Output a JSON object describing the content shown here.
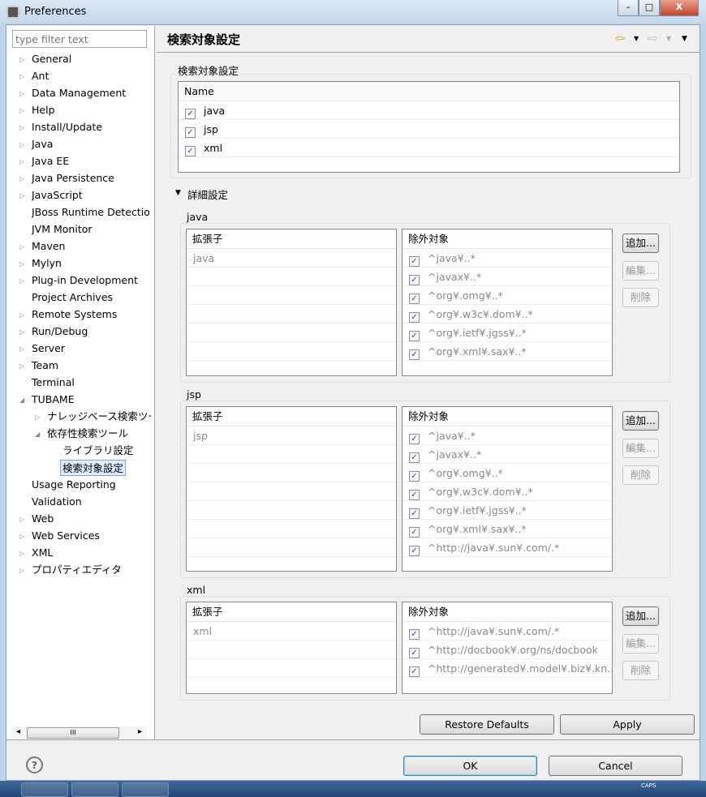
{
  "window": {
    "title": "Preferences",
    "minimize": "–",
    "maximize": "□",
    "close": "X"
  },
  "filter": {
    "placeholder": "type filter text"
  },
  "tree": [
    {
      "label": "General",
      "twisty": "▷",
      "level": 0
    },
    {
      "label": "Ant",
      "twisty": "▷",
      "level": 0
    },
    {
      "label": "Data Management",
      "twisty": "▷",
      "level": 0
    },
    {
      "label": "Help",
      "twisty": "▷",
      "level": 0
    },
    {
      "label": "Install/Update",
      "twisty": "▷",
      "level": 0
    },
    {
      "label": "Java",
      "twisty": "▷",
      "level": 0
    },
    {
      "label": "Java EE",
      "twisty": "▷",
      "level": 0
    },
    {
      "label": "Java Persistence",
      "twisty": "▷",
      "level": 0
    },
    {
      "label": "JavaScript",
      "twisty": "▷",
      "level": 0
    },
    {
      "label": "JBoss Runtime Detection",
      "twisty": "",
      "level": 0
    },
    {
      "label": "JVM Monitor",
      "twisty": "",
      "level": 0
    },
    {
      "label": "Maven",
      "twisty": "▷",
      "level": 0
    },
    {
      "label": "Mylyn",
      "twisty": "▷",
      "level": 0
    },
    {
      "label": "Plug-in Development",
      "twisty": "▷",
      "level": 0
    },
    {
      "label": "Project Archives",
      "twisty": "",
      "level": 0
    },
    {
      "label": "Remote Systems",
      "twisty": "▷",
      "level": 0
    },
    {
      "label": "Run/Debug",
      "twisty": "▷",
      "level": 0
    },
    {
      "label": "Server",
      "twisty": "▷",
      "level": 0
    },
    {
      "label": "Team",
      "twisty": "▷",
      "level": 0
    },
    {
      "label": "Terminal",
      "twisty": "",
      "level": 0
    },
    {
      "label": "TUBAME",
      "twisty": "◢",
      "level": 0
    },
    {
      "label": "ナレッジベース検索ツール",
      "twisty": "▷",
      "level": 1
    },
    {
      "label": "依存性検索ツール",
      "twisty": "◢",
      "level": 1
    },
    {
      "label": "ライブラリ設定",
      "twisty": "",
      "level": 2
    },
    {
      "label": "検索対象設定",
      "twisty": "",
      "level": 2,
      "selected": true
    },
    {
      "label": "Usage Reporting",
      "twisty": "",
      "level": 0
    },
    {
      "label": "Validation",
      "twisty": "",
      "level": 0
    },
    {
      "label": "Web",
      "twisty": "▷",
      "level": 0
    },
    {
      "label": "Web Services",
      "twisty": "▷",
      "level": 0
    },
    {
      "label": "XML",
      "twisty": "▷",
      "level": 0
    },
    {
      "label": "プロパティエディタ",
      "twisty": "▷",
      "level": 0
    }
  ],
  "page": {
    "title": "検索対象設定",
    "back_icon": "⇦",
    "forward_icon": "⇨",
    "menu_icon": "▼"
  },
  "target_group": {
    "label": "検索対象設定",
    "column": "Name",
    "items": [
      "java",
      "jsp",
      "xml"
    ]
  },
  "details": {
    "label": "詳細設定",
    "expanded": true
  },
  "sections": [
    {
      "name": "java",
      "ext_header": "拡張子",
      "extensions": [
        "java"
      ],
      "excl_header": "除外対象",
      "exclusions": [
        "^java¥..*",
        "^javax¥..*",
        "^org¥.omg¥..*",
        "^org¥.w3c¥.dom¥..*",
        "^org¥.ietf¥.jgss¥..*",
        "^org¥.xml¥.sax¥..*"
      ]
    },
    {
      "name": "jsp",
      "ext_header": "拡張子",
      "extensions": [
        "jsp"
      ],
      "excl_header": "除外対象",
      "exclusions": [
        "^java¥..*",
        "^javax¥..*",
        "^org¥.omg¥..*",
        "^org¥.w3c¥.dom¥..*",
        "^org¥.ietf¥.jgss¥..*",
        "^org¥.xml¥.sax¥..*",
        "^http://java¥.sun¥.com/.*"
      ]
    },
    {
      "name": "xml",
      "ext_header": "拡張子",
      "extensions": [
        "xml"
      ],
      "excl_header": "除外対象",
      "exclusions": [
        "^http://java¥.sun¥.com/.*",
        "^http://docbook¥.org/ns/docbook",
        "^http://generated¥.model¥.biz¥.kn..."
      ]
    }
  ],
  "side_buttons": {
    "add": "追加...",
    "edit": "編集...",
    "delete": "削除"
  },
  "buttons": {
    "restore": "Restore Defaults",
    "apply": "Apply",
    "ok": "OK",
    "cancel": "Cancel",
    "help": "?"
  },
  "scroll": {
    "grip": "III",
    "left": "◂",
    "right": "▸"
  },
  "taskbar": {
    "caps": "CAPS"
  }
}
